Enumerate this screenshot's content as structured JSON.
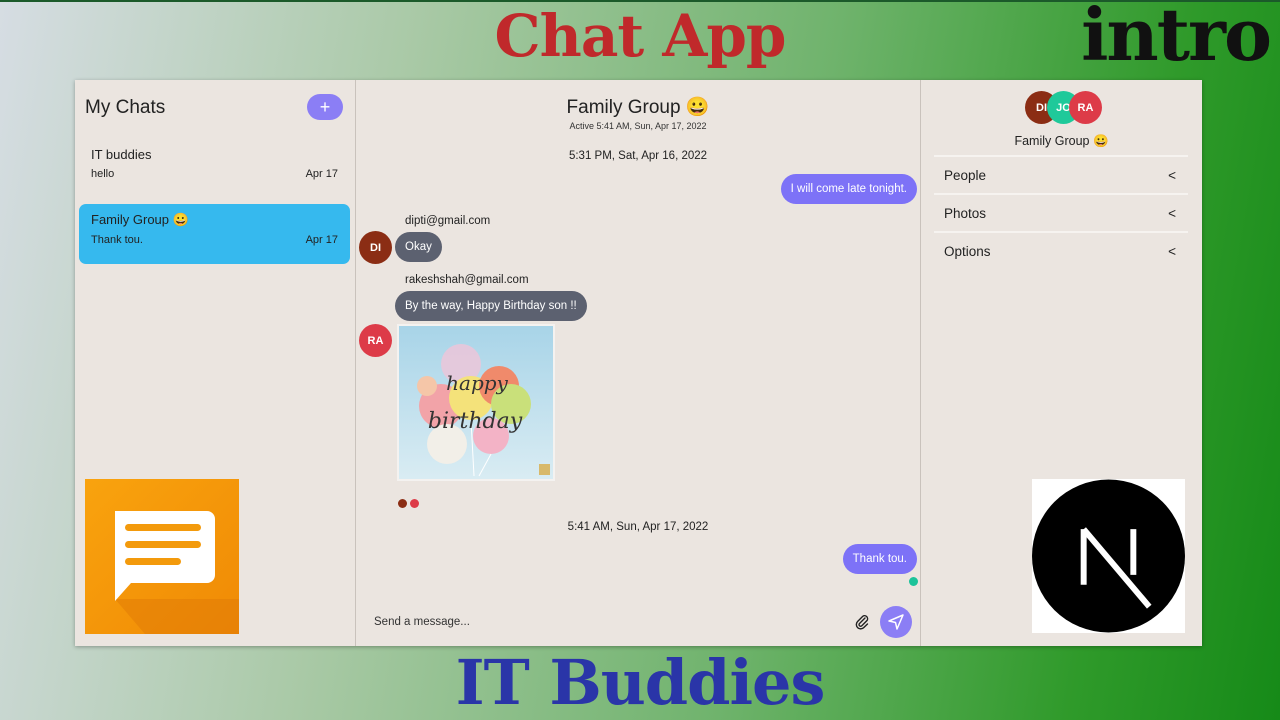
{
  "overlay": {
    "title_top": "Chat App",
    "intro": "intro",
    "title_bottom": "IT Buddies"
  },
  "sidebar": {
    "heading": "My Chats",
    "new_chat_label": "+",
    "chats": [
      {
        "name": "IT buddies",
        "last_message": "hello",
        "date": "Apr 17",
        "active": false
      },
      {
        "name": "Family Group 😀",
        "last_message": "Thank tou.",
        "date": "Apr 17",
        "active": true
      }
    ]
  },
  "conversation": {
    "title": "Family Group 😀",
    "status": "Active 5:41 AM, Sun, Apr 17, 2022",
    "date_sep_1": "5:31 PM, Sat, Apr 16, 2022",
    "date_sep_2": "5:41 AM, Sun, Apr 17, 2022",
    "messages": [
      {
        "from": "me",
        "text": "I will come late tonight."
      },
      {
        "from": "dipti@gmail.com",
        "avatar": "DI",
        "text": "Okay"
      },
      {
        "from": "rakeshshah@gmail.com",
        "avatar": "RA",
        "text": "By the way, Happy Birthday son !!"
      },
      {
        "from": "me",
        "text": "Thank tou."
      }
    ],
    "image_text": [
      "happy",
      "birthday"
    ],
    "composer_placeholder": "Send a message..."
  },
  "details": {
    "avatars": [
      "DI",
      "JO",
      "RA"
    ],
    "group_name": "Family Group 😀",
    "menu": [
      "People",
      "Photos",
      "Options"
    ],
    "chevron": "<"
  },
  "colors": {
    "accent": "#8b7ef5",
    "active_chat": "#36b9ee",
    "incoming_bubble": "#5c6170",
    "panel_bg": "#ebe5e0",
    "online": "#1cc39a"
  }
}
